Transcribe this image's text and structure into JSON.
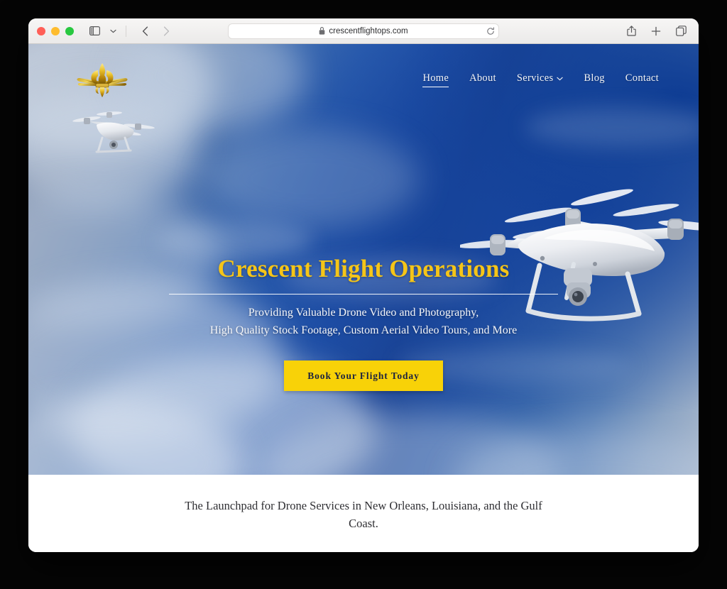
{
  "browser": {
    "traffic_lights": [
      "close",
      "minimize",
      "maximize"
    ],
    "sidebar_toggle_label": "Show sidebar",
    "sidebar_dropdown_label": "Sidebar options",
    "back_label": "Back",
    "forward_label": "Forward",
    "url": "crescentflightops.com",
    "lock_icon": "lock-icon",
    "reload_label": "Reload",
    "share_label": "Share",
    "new_tab_label": "New Tab",
    "tab_overview_label": "Tab Overview"
  },
  "site": {
    "logo_alt": "Crescent Flight Operations fleur-de-lis wings logo",
    "nav": [
      {
        "label": "Home",
        "active": true,
        "has_dropdown": false
      },
      {
        "label": "About",
        "active": false,
        "has_dropdown": false
      },
      {
        "label": "Services",
        "active": false,
        "has_dropdown": true
      },
      {
        "label": "Blog",
        "active": false,
        "has_dropdown": false
      },
      {
        "label": "Contact",
        "active": false,
        "has_dropdown": false
      }
    ],
    "hero": {
      "title": "Crescent Flight Operations",
      "subtitle_line1": "Providing Valuable Drone Video and Photography,",
      "subtitle_line2": "High Quality Stock Footage, Custom Aerial Video Tours, and More",
      "cta_label": "Book Your Flight Today",
      "drone_small_alt": "white quadcopter drone in flight",
      "drone_large_alt": "large white quadcopter drone with gimbal camera"
    },
    "tagline": "The Launchpad for Drone Services in New Orleans, Louisiana, and the Gulf Coast."
  },
  "colors": {
    "accent_gold": "#f5c518",
    "cta_yellow": "#f8d208",
    "cta_text": "#1c2340",
    "sky_deep_blue": "#1c4596",
    "sky_haze": "#8e9cb4",
    "nav_text": "#f2f3f6"
  }
}
